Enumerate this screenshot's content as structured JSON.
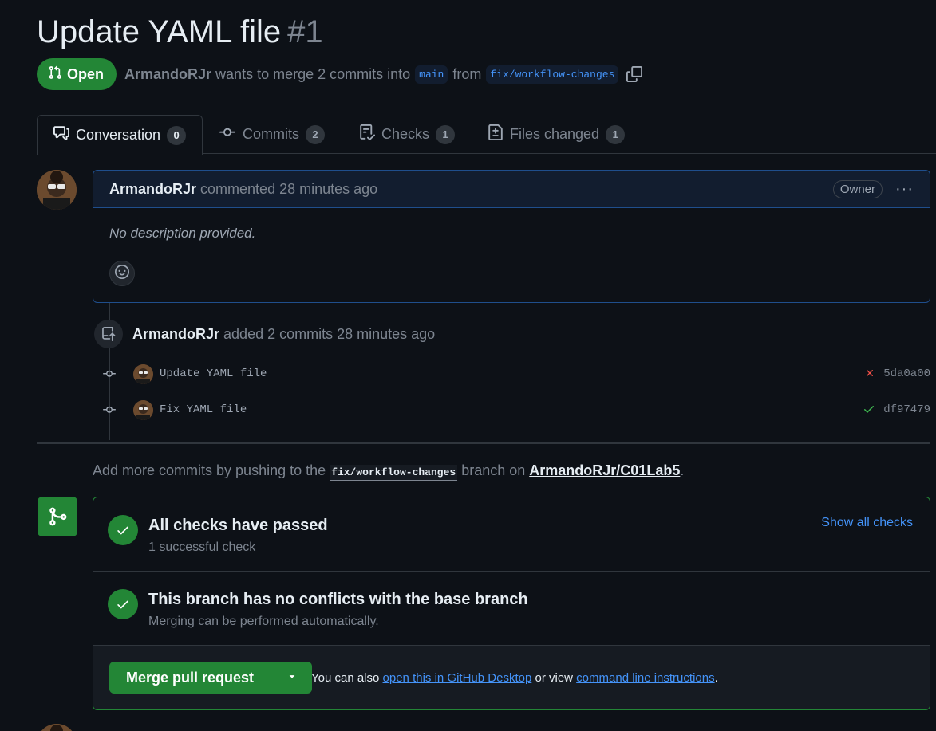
{
  "pr": {
    "title": "Update YAML file",
    "number": "#1",
    "state": "Open",
    "author": "ArmandoRJr",
    "merge_text": "wants to merge 2 commits into",
    "base_branch": "main",
    "from_text": "from",
    "head_branch": "fix/workflow-changes"
  },
  "tabs": [
    {
      "label": "Conversation",
      "count": "0",
      "icon": "conversation-icon"
    },
    {
      "label": "Commits",
      "count": "2",
      "icon": "commit-icon"
    },
    {
      "label": "Checks",
      "count": "1",
      "icon": "checklist-icon"
    },
    {
      "label": "Files changed",
      "count": "1",
      "icon": "file-diff-icon"
    }
  ],
  "comment": {
    "author": "ArmandoRJr",
    "action": "commented 28 minutes ago",
    "badge": "Owner",
    "body": "No description provided."
  },
  "commits_event": {
    "author": "ArmandoRJr",
    "action": "added 2 commits",
    "time": "28 minutes ago",
    "commits": [
      {
        "message": "Update YAML file",
        "sha": "5da0a00",
        "status": "failure",
        "status_color": "#f85149"
      },
      {
        "message": "Fix YAML file",
        "sha": "df97479",
        "status": "success",
        "status_color": "#3fb950"
      }
    ]
  },
  "hint": {
    "prefix": "Add more commits by pushing to the",
    "branch": "fix/workflow-changes",
    "middle": "branch on",
    "repo": "ArmandoRJr/C01Lab5",
    "suffix": "."
  },
  "merge_box": {
    "checks_title": "All checks have passed",
    "checks_sub": "1 successful check",
    "show_checks": "Show all checks",
    "conflicts_title": "This branch has no conflicts with the base branch",
    "conflicts_sub": "Merging can be performed automatically.",
    "merge_button": "Merge pull request",
    "note_prefix": "You can also",
    "note_link1": "open this in GitHub Desktop",
    "note_middle": "or view",
    "note_link2": "command line instructions",
    "note_suffix": "."
  },
  "colors": {
    "background": "#0d1117",
    "accent_green": "#238636",
    "link_blue": "#4493f8",
    "muted": "#7d8590"
  }
}
